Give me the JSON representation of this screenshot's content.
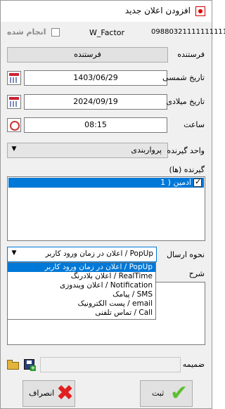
{
  "window": {
    "title": "افزودن اعلان جدید"
  },
  "header": {
    "phone": "09880321111111111",
    "factor": "W_Factor",
    "done_label": "انجام شده"
  },
  "sender": {
    "label": "فرستنده",
    "button": "فرستنده"
  },
  "shamsi": {
    "label": "تاریخ شمسی",
    "value": "1403/06/29"
  },
  "miladi": {
    "label": "تاریخ میلادی",
    "value": "2024/09/19"
  },
  "time": {
    "label": "ساعت",
    "value": "08:15"
  },
  "unit": {
    "label": "واحد گیرنده",
    "value": "پرواربندی"
  },
  "recipients": {
    "label": "گیرنده (ها)",
    "items": [
      "1 ) ادمین"
    ]
  },
  "send_method": {
    "label": "نحوه ارسال",
    "value": "اعلان در زمان ورود کاربر / PopUp",
    "options": [
      "اعلان در زمان ورود کاربر / PopUp",
      "اعلان بلادرنگ / RealTime",
      "اعلان ویندوزی / Notification",
      "پیامک / SMS",
      "پست الکترونیک / email",
      "تماس تلفنی / Call"
    ]
  },
  "description": {
    "label": "شرح"
  },
  "attachment": {
    "label": "ضمیمه"
  },
  "footer": {
    "save": "ثبت",
    "cancel": "انصراف"
  }
}
